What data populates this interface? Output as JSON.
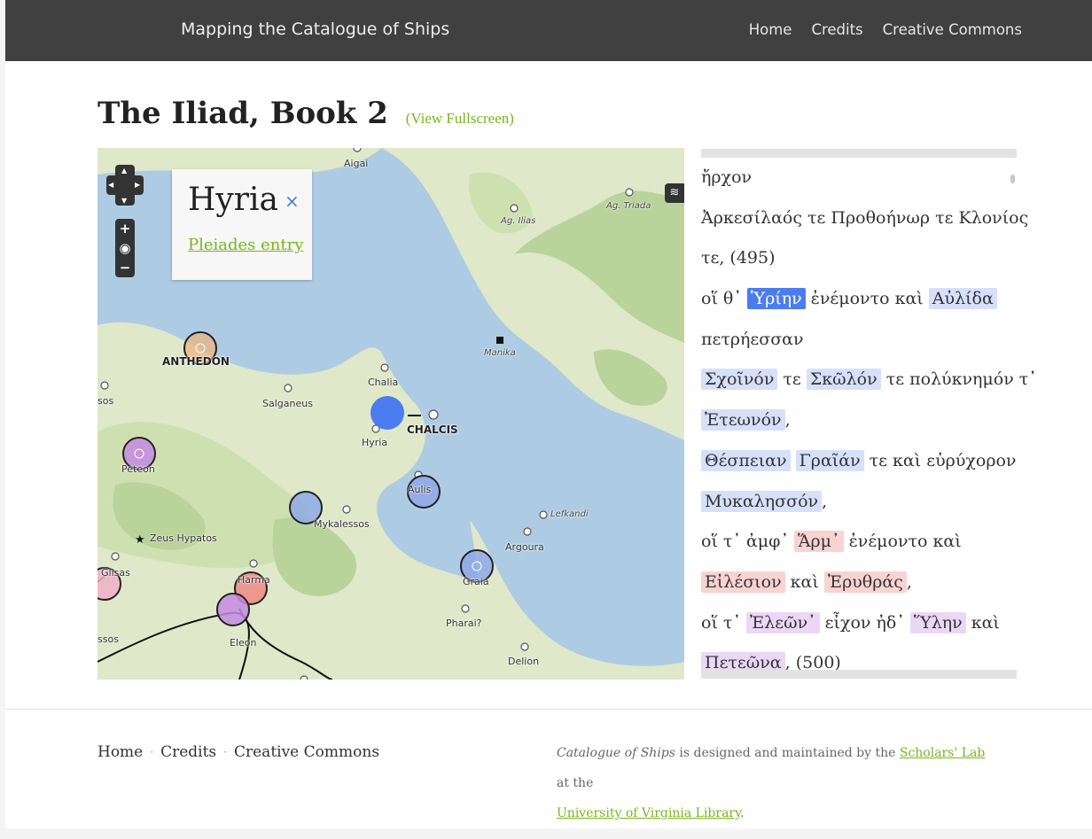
{
  "header": {
    "brand": "Mapping the Catalogue of Ships",
    "nav": [
      "Home",
      "Credits",
      "Creative Commons"
    ]
  },
  "title": {
    "text": "The Iliad, Book 2",
    "fullscreen_link": "View Fullscreen",
    "open_paren": "(",
    "close_paren": ")"
  },
  "map": {
    "popup": {
      "title": "Hyria",
      "close": "×",
      "link": "Pleiades entry"
    },
    "controls": {
      "zoom_in": "+",
      "globe": "◉",
      "zoom_out": "−"
    },
    "labels": {
      "aigai": "Aigai",
      "ag_ilias": "Ag. Ilias",
      "ag_triada": "Ag. Triada",
      "anthedon": "ANTHEDON",
      "salganeus": "Salganeus",
      "chalia": "Chalia",
      "chalcis": "CHALCIS",
      "hyria": "Hyria",
      "manika": "Manika",
      "peteon": "Peteon",
      "aulis": "Aulis",
      "mykalessos": "Mykalessos",
      "lefkandi": "Lefkandi",
      "argoura": "Argoura",
      "zeus_hypatos": "Zeus Hypatos",
      "glisas": "Glisas",
      "harma": "Harma",
      "graia": "Graia",
      "pharai": "Pharai?",
      "eleon": "Eleon",
      "delion": "Delion",
      "sos": "sos",
      "ssos": "ssos"
    },
    "colors": {
      "sea": "#aecbe4",
      "land": "#dfe8c8",
      "forest": "#b9d39b",
      "blue_marker": "#4b7cf0",
      "red_marker": "#f08a84",
      "purple_marker": "#c48be0",
      "orange_marker": "#f0b27a"
    }
  },
  "verses": [
    [
      {
        "t": "ἤρχον"
      }
    ],
    [
      {
        "t": "Ἀρκεσίλαός τε Προθοήνωρ τε Κλονίος"
      }
    ],
    [
      {
        "t": "τε, (495)"
      }
    ],
    [
      {
        "t": "οἵ θ᾽ "
      },
      {
        "t": "Ὑρίην",
        "c": "active"
      },
      {
        "t": " ἐνέμοντο καὶ "
      },
      {
        "t": "Αὐλίδα",
        "c": "blue"
      }
    ],
    [
      {
        "t": "πετρήεσσαν"
      }
    ],
    [
      {
        "t": "Σχοῖνόν",
        "c": "blue"
      },
      {
        "t": " τε "
      },
      {
        "t": "Σκῶλόν",
        "c": "blue"
      },
      {
        "t": " τε πολύκνημόν τ᾽"
      }
    ],
    [
      {
        "t": "Ἐτεωνόν",
        "c": "blue"
      },
      {
        "t": ","
      }
    ],
    [
      {
        "t": "Θέσπειαν",
        "c": "blue"
      },
      {
        "t": " "
      },
      {
        "t": "Γραῖάν",
        "c": "blue"
      },
      {
        "t": " τε καὶ εὐρύχορον"
      }
    ],
    [
      {
        "t": "Μυκαλησσόν",
        "c": "blue"
      },
      {
        "t": ","
      }
    ],
    [
      {
        "t": "οἵ τ᾽ ἀμφ᾽ "
      },
      {
        "t": "Ἅρμ᾽",
        "c": "red"
      },
      {
        "t": " ἐνέμοντο καὶ"
      }
    ],
    [
      {
        "t": "Εἰλέσιον",
        "c": "red"
      },
      {
        "t": " καὶ "
      },
      {
        "t": "Ἐρυθράς",
        "c": "red"
      },
      {
        "t": ","
      }
    ],
    [
      {
        "t": "οἵ τ᾽ "
      },
      {
        "t": "Ἐλεῶν᾽",
        "c": "purple"
      },
      {
        "t": " εἶχον ἠδ᾽ "
      },
      {
        "t": "Ὕλην",
        "c": "purple"
      },
      {
        "t": " καὶ"
      }
    ],
    [
      {
        "t": "Πετεῶνα",
        "c": "purple"
      },
      {
        "t": ", (500)"
      }
    ]
  ],
  "footer": {
    "nav": [
      "Home",
      "Credits",
      "Creative Commons"
    ],
    "separator": "·",
    "credit_title": "Catalogue of Ships",
    "credit_mid": " is designed and maintained by the ",
    "credit_link1": "Scholars' Lab",
    "credit_at": " at the",
    "credit_link2": "University of Virginia Library",
    "credit_end": "."
  }
}
